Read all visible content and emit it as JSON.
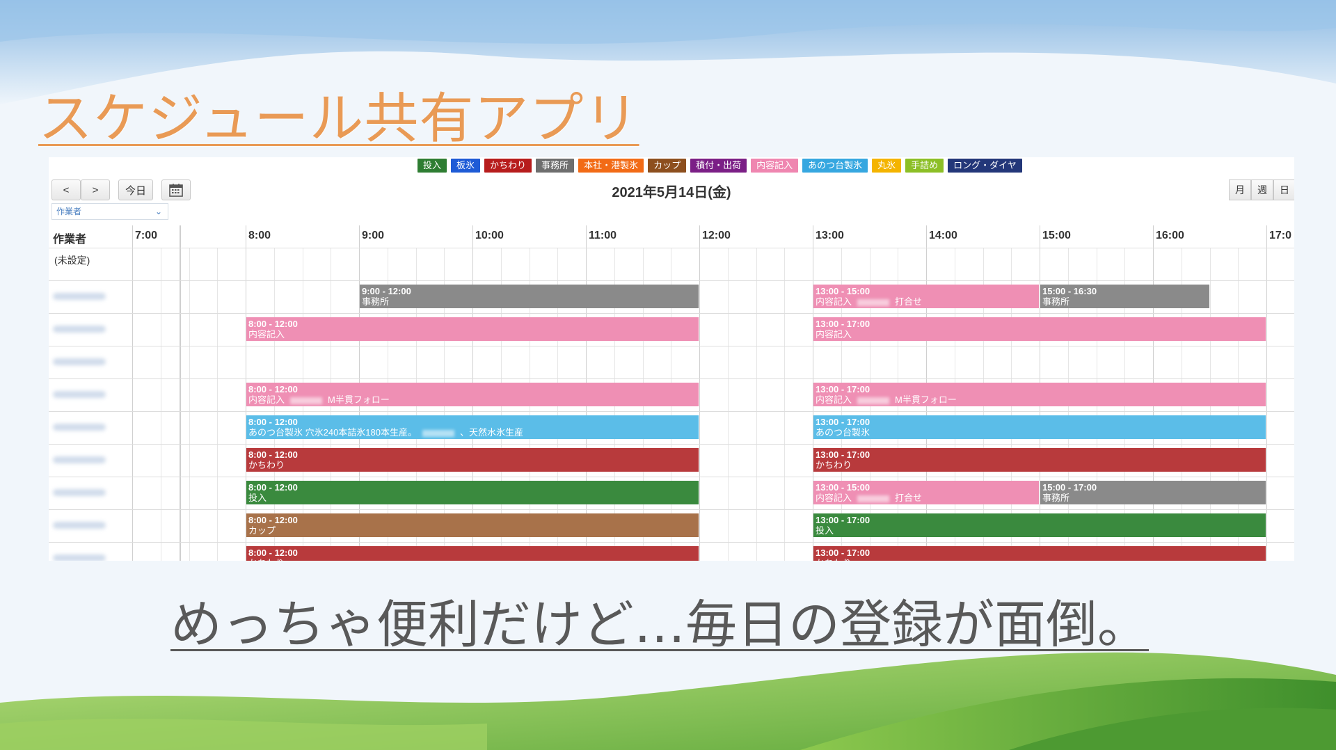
{
  "slide": {
    "title": "スケジュール共有アプリ",
    "caption": "めっちゃ便利だけど…毎日の登録が面倒。"
  },
  "legend": [
    {
      "label": "投入",
      "color": "#2e7d32"
    },
    {
      "label": "板氷",
      "color": "#1e5bd6"
    },
    {
      "label": "かちわり",
      "color": "#b71c1c"
    },
    {
      "label": "事務所",
      "color": "#6e6e6e"
    },
    {
      "label": "本社・港製氷",
      "color": "#f26b16"
    },
    {
      "label": "カップ",
      "color": "#8d4f1e"
    },
    {
      "label": "積付・出荷",
      "color": "#7b1f86"
    },
    {
      "label": "内容記入",
      "color": "#ef86b0"
    },
    {
      "label": "あのつ台製氷",
      "color": "#36a7e0"
    },
    {
      "label": "丸氷",
      "color": "#f4b400"
    },
    {
      "label": "手詰め",
      "color": "#8cbf26"
    },
    {
      "label": "ロング・ダイヤ",
      "color": "#233779"
    }
  ],
  "toolbar": {
    "prev": "<",
    "next": ">",
    "today": "今日",
    "calendar_icon": "calendar-icon",
    "date": "2021年5月14日(金)",
    "worker_filter": "作業者",
    "views": [
      "月",
      "週",
      "日"
    ]
  },
  "grid": {
    "worker_header": "作業者",
    "hours": [
      "7:00",
      "8:00",
      "9:00",
      "10:00",
      "11:00",
      "12:00",
      "13:00",
      "14:00",
      "15:00",
      "16:00",
      "17:0"
    ],
    "unset_row": "(未設定)"
  },
  "events": [
    {
      "row": 1,
      "start": 9,
      "end": 12,
      "time": "9:00 - 12:00",
      "name": "事務所",
      "color": "#8a8a8a"
    },
    {
      "row": 1,
      "start": 13,
      "end": 15,
      "time": "13:00 - 15:00",
      "name": "内容記入",
      "extra": "打合せ",
      "color": "#ef8fb4"
    },
    {
      "row": 1,
      "start": 15,
      "end": 16.5,
      "time": "15:00 - 16:30",
      "name": "事務所",
      "color": "#8a8a8a"
    },
    {
      "row": 2,
      "start": 8,
      "end": 12,
      "time": "8:00 - 12:00",
      "name": "内容記入",
      "color": "#ef8fb4"
    },
    {
      "row": 2,
      "start": 13,
      "end": 17,
      "time": "13:00 - 17:00",
      "name": "内容記入",
      "color": "#ef8fb4"
    },
    {
      "row": 4,
      "start": 8,
      "end": 12,
      "time": "8:00 - 12:00",
      "name": "内容記入",
      "extra": "M半貫フォロー",
      "color": "#ef8fb4"
    },
    {
      "row": 4,
      "start": 13,
      "end": 17,
      "time": "13:00 - 17:00",
      "name": "内容記入",
      "extra": "M半貫フォロー",
      "color": "#ef8fb4"
    },
    {
      "row": 5,
      "start": 8,
      "end": 12,
      "time": "8:00 - 12:00",
      "name": "あのつ台製氷 穴氷240本詰氷180本生産。",
      "extra": "、天然水氷生産",
      "color": "#5bbde8"
    },
    {
      "row": 5,
      "start": 13,
      "end": 17,
      "time": "13:00 - 17:00",
      "name": "あのつ台製氷",
      "color": "#5bbde8"
    },
    {
      "row": 6,
      "start": 8,
      "end": 12,
      "time": "8:00 - 12:00",
      "name": "かちわり",
      "color": "#b83a3c"
    },
    {
      "row": 6,
      "start": 13,
      "end": 17,
      "time": "13:00 - 17:00",
      "name": "かちわり",
      "color": "#b83a3c"
    },
    {
      "row": 7,
      "start": 8,
      "end": 12,
      "time": "8:00 - 12:00",
      "name": "投入",
      "color": "#3a8a3e"
    },
    {
      "row": 7,
      "start": 13,
      "end": 15,
      "time": "13:00 - 15:00",
      "name": "内容記入",
      "extra": "打合せ",
      "color": "#ef8fb4"
    },
    {
      "row": 7,
      "start": 15,
      "end": 17,
      "time": "15:00 - 17:00",
      "name": "事務所",
      "color": "#8a8a8a"
    },
    {
      "row": 8,
      "start": 8,
      "end": 12,
      "time": "8:00 - 12:00",
      "name": "カップ",
      "color": "#a8724a"
    },
    {
      "row": 8,
      "start": 13,
      "end": 17,
      "time": "13:00 - 17:00",
      "name": "投入",
      "color": "#3a8a3e"
    },
    {
      "row": 9,
      "start": 8,
      "end": 12,
      "time": "8:00 - 12:00",
      "name": "かちわり",
      "color": "#b83a3c"
    },
    {
      "row": 9,
      "start": 13,
      "end": 17,
      "time": "13:00 - 17:00",
      "name": "かちわり",
      "color": "#b83a3c"
    }
  ]
}
